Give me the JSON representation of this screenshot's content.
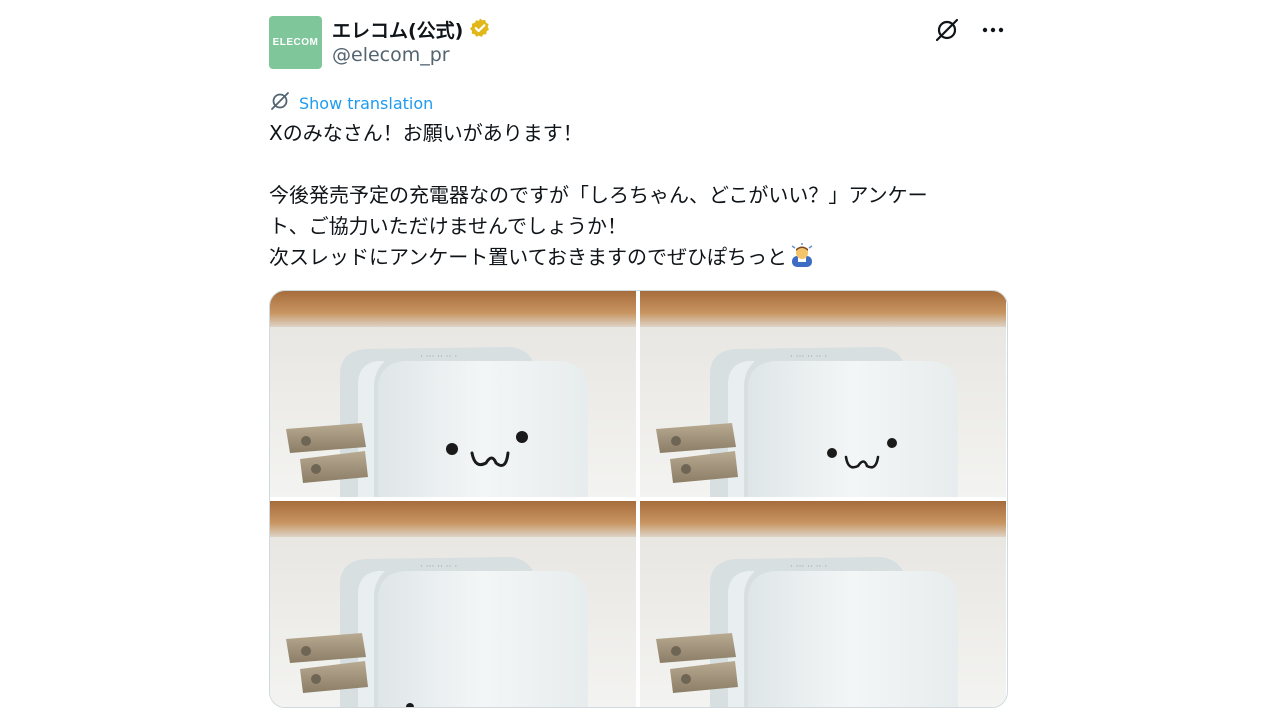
{
  "author": {
    "avatar_text": "ELECOM",
    "display_name": "エレコム(公式)",
    "handle": "@elecom_pr",
    "verified_color": "#e2b719",
    "avatar_color": "#7fc79a"
  },
  "actions": {
    "grok_icon": "grok-icon",
    "more_icon": "more-icon"
  },
  "translation": {
    "label": "Show translation"
  },
  "tweet": {
    "lines": [
      "Xのみなさん！お願いがあります！",
      "",
      "今後発売予定の充電器なのですが「しろちゃん、どこがいい？」アンケー",
      "ト、ご協力いただけませんでしょうか！",
      "次スレッドにアンケート置いておきますのでぜひぽちっと"
    ],
    "emoji": "man-bowing-emoji"
  },
  "media": {
    "count": 4,
    "images": [
      "charger-photo-1",
      "charger-photo-2",
      "charger-photo-3",
      "charger-photo-4"
    ]
  },
  "colors": {
    "link": "#1d9bf0",
    "secondary_text": "#536471"
  }
}
